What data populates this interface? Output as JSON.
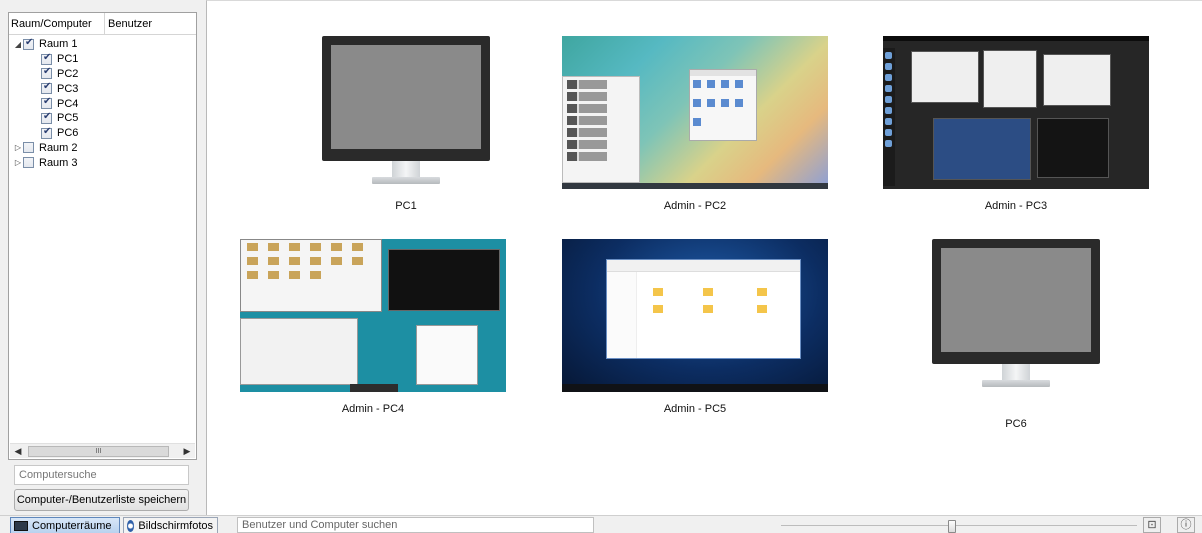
{
  "tree": {
    "columns": [
      "Raum/Computer",
      "Benutzer"
    ],
    "rows": [
      {
        "label": "Raum 1",
        "level": 0,
        "expanded": true,
        "checked": true
      },
      {
        "label": "PC1",
        "level": 1,
        "checked": true
      },
      {
        "label": "PC2",
        "level": 1,
        "checked": true
      },
      {
        "label": "PC3",
        "level": 1,
        "checked": true
      },
      {
        "label": "PC4",
        "level": 1,
        "checked": true
      },
      {
        "label": "PC5",
        "level": 1,
        "checked": true
      },
      {
        "label": "PC6",
        "level": 1,
        "checked": true
      },
      {
        "label": "Raum 2",
        "level": 0,
        "expanded": false,
        "checked": false
      },
      {
        "label": "Raum 3",
        "level": 0,
        "expanded": false,
        "checked": false
      }
    ],
    "scroll_thumb_glyph": "III"
  },
  "computer_search": {
    "placeholder": "Computersuche"
  },
  "save_list_label": "Computer-/Benutzerliste speichern",
  "screens": [
    {
      "label": "PC1",
      "kind": "monitor"
    },
    {
      "label": "Admin - PC2",
      "kind": "kde"
    },
    {
      "label": "Admin - PC3",
      "kind": "gnome"
    },
    {
      "label": "Admin - PC4",
      "kind": "xfce"
    },
    {
      "label": "Admin - PC5",
      "kind": "win10"
    },
    {
      "label": "PC6",
      "kind": "monitor"
    }
  ],
  "bottom_bar": {
    "computerraeume_label": "Computerräume",
    "bildschirmfotos_label": "Bildschirmfotos",
    "search_placeholder": "Benutzer und Computer suchen",
    "zoom_level": 0.48
  },
  "colors": {
    "accent": "#5f87bb",
    "active_mode_bg": "#c9ddf4"
  }
}
